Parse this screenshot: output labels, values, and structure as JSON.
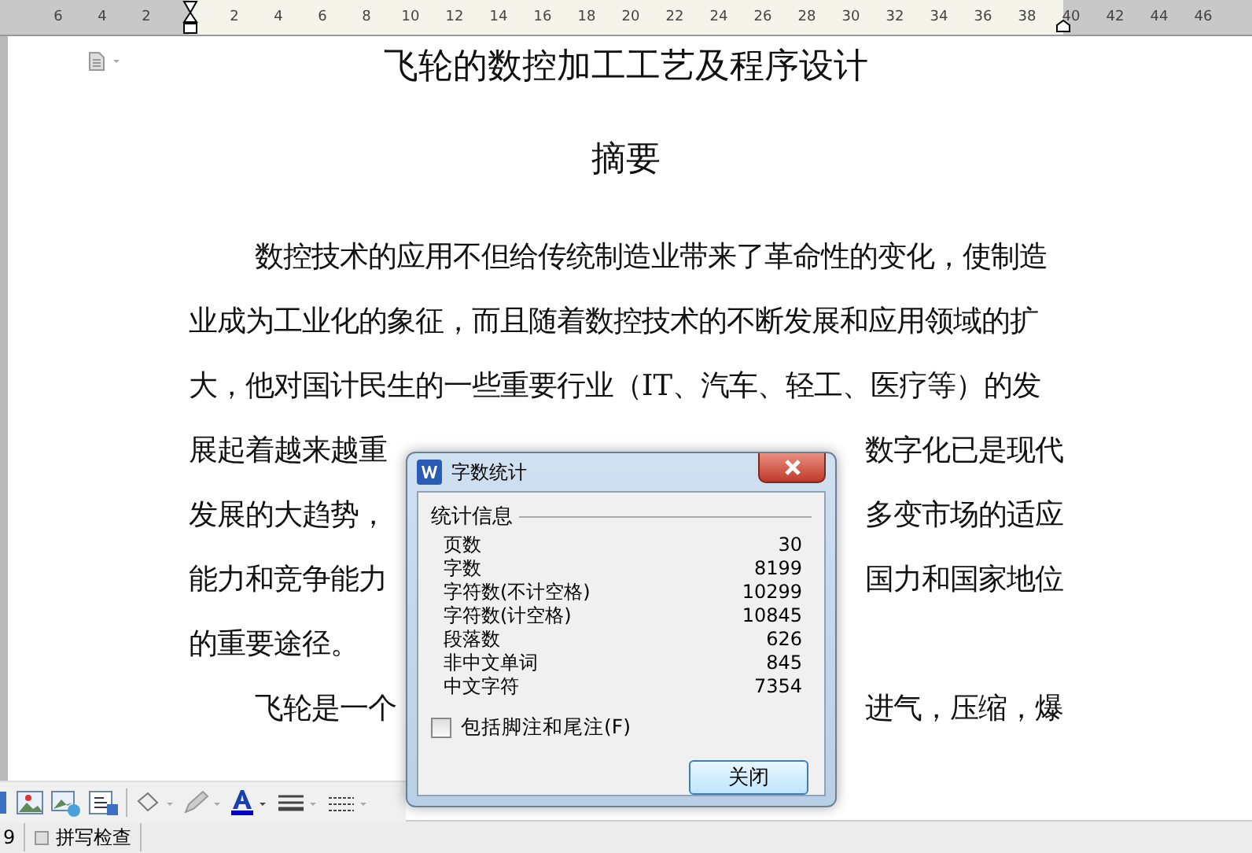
{
  "ruler": {
    "ticks": [
      "6",
      "4",
      "2",
      "2",
      "4",
      "6",
      "8",
      "10",
      "12",
      "14",
      "16",
      "18",
      "20",
      "22",
      "24",
      "26",
      "28",
      "30",
      "32",
      "34",
      "36",
      "38",
      "40",
      "42",
      "44",
      "46"
    ]
  },
  "document": {
    "title": "飞轮的数控加工工艺及程序设计",
    "heading": "摘要",
    "lines": [
      {
        "kind": "full",
        "indent": true,
        "text": "数控技术的应用不但给传统制造业带来了革命性的变化，使制造"
      },
      {
        "kind": "full",
        "indent": false,
        "text": "业成为工业化的象征，而且随着数控技术的不断发展和应用领域的扩"
      },
      {
        "kind": "full",
        "indent": false,
        "text": "大，他对国计民生的一些重要行业（IT、汽车、轻工、医疗等）的发"
      },
      {
        "kind": "split",
        "indent": false,
        "left": "展起着越来越重",
        "right": "数字化已是现代"
      },
      {
        "kind": "split",
        "indent": false,
        "left": "发展的大趋势，",
        "right": "多变市场的适应"
      },
      {
        "kind": "split",
        "indent": false,
        "left": "能力和竞争能力",
        "right": "国力和国家地位"
      },
      {
        "kind": "full",
        "indent": false,
        "text": "的重要途径。"
      },
      {
        "kind": "split",
        "indent": true,
        "left": "飞轮是一个",
        "right": "进气，压缩，爆"
      }
    ]
  },
  "dialog": {
    "title": "字数统计",
    "group": "统计信息",
    "stats": [
      {
        "label": "页数",
        "value": "30"
      },
      {
        "label": "字数",
        "value": "8199"
      },
      {
        "label": "字符数(不计空格)",
        "value": "10299"
      },
      {
        "label": "字符数(计空格)",
        "value": "10845"
      },
      {
        "label": "段落数",
        "value": "626"
      },
      {
        "label": "非中文单词",
        "value": "845"
      },
      {
        "label": "中文字符",
        "value": "7354"
      }
    ],
    "checkbox": {
      "label": "包括脚注和尾注(F)",
      "checked": false
    },
    "button": "关闭"
  },
  "status_bar": {
    "page": "9",
    "spell_check": "拼写检查"
  }
}
